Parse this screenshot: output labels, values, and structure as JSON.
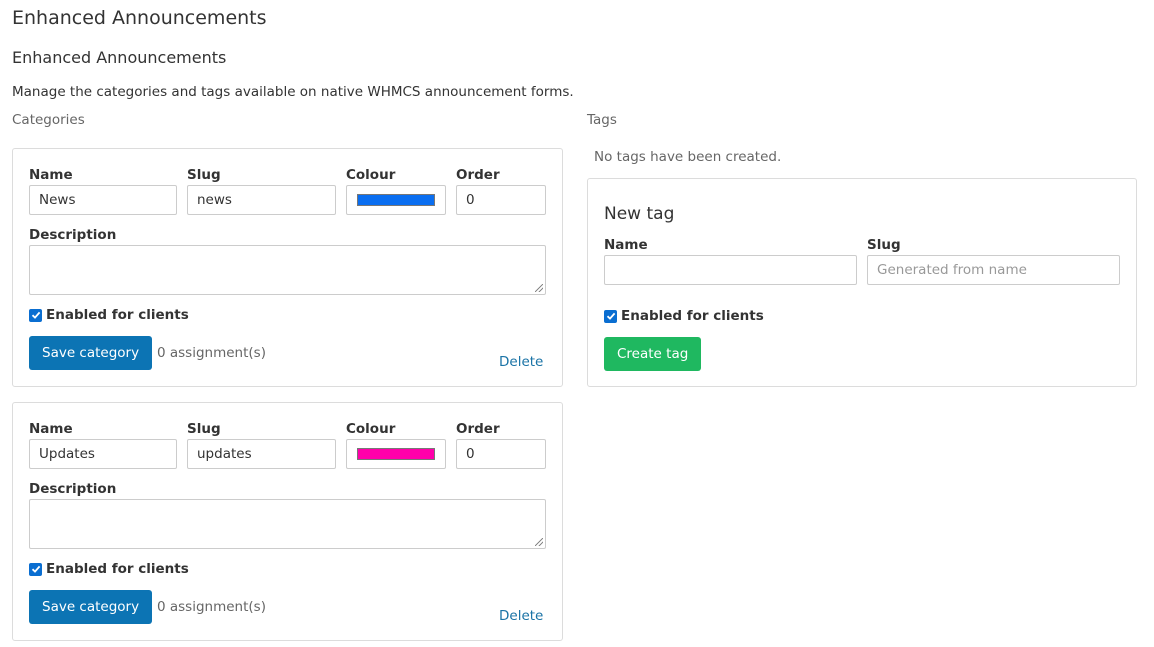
{
  "page": {
    "title": "Enhanced Announcements",
    "section_title": "Enhanced Announcements",
    "intro": "Manage the categories and tags available on native WHMCS announcement forms."
  },
  "categories": {
    "heading": "Categories",
    "field_labels": {
      "name": "Name",
      "slug": "Slug",
      "colour": "Colour",
      "order": "Order",
      "description": "Description",
      "enabled": "Enabled for clients"
    },
    "items": [
      {
        "name": "News",
        "slug": "news",
        "colour": "#0a6ef0",
        "order": "0",
        "description": "",
        "enabled": true,
        "save_label": "Save category",
        "assignments": "0 assignment(s)",
        "delete_label": "Delete"
      },
      {
        "name": "Updates",
        "slug": "updates",
        "colour": "#ff00aa",
        "order": "0",
        "description": "",
        "enabled": true,
        "save_label": "Save category",
        "assignments": "0 assignment(s)",
        "delete_label": "Delete"
      }
    ]
  },
  "tags": {
    "heading": "Tags",
    "empty_message": "No tags have been created.",
    "new_tag": {
      "title": "New tag",
      "name_label": "Name",
      "slug_label": "Slug",
      "name_value": "",
      "slug_placeholder": "Generated from name",
      "enabled_label": "Enabled for clients",
      "enabled": true,
      "create_label": "Create tag"
    }
  },
  "colors": {
    "primary": "#0c74b4",
    "success": "#1fb860",
    "link": "#1a73a6",
    "checkbox": "#0a6ed1"
  }
}
